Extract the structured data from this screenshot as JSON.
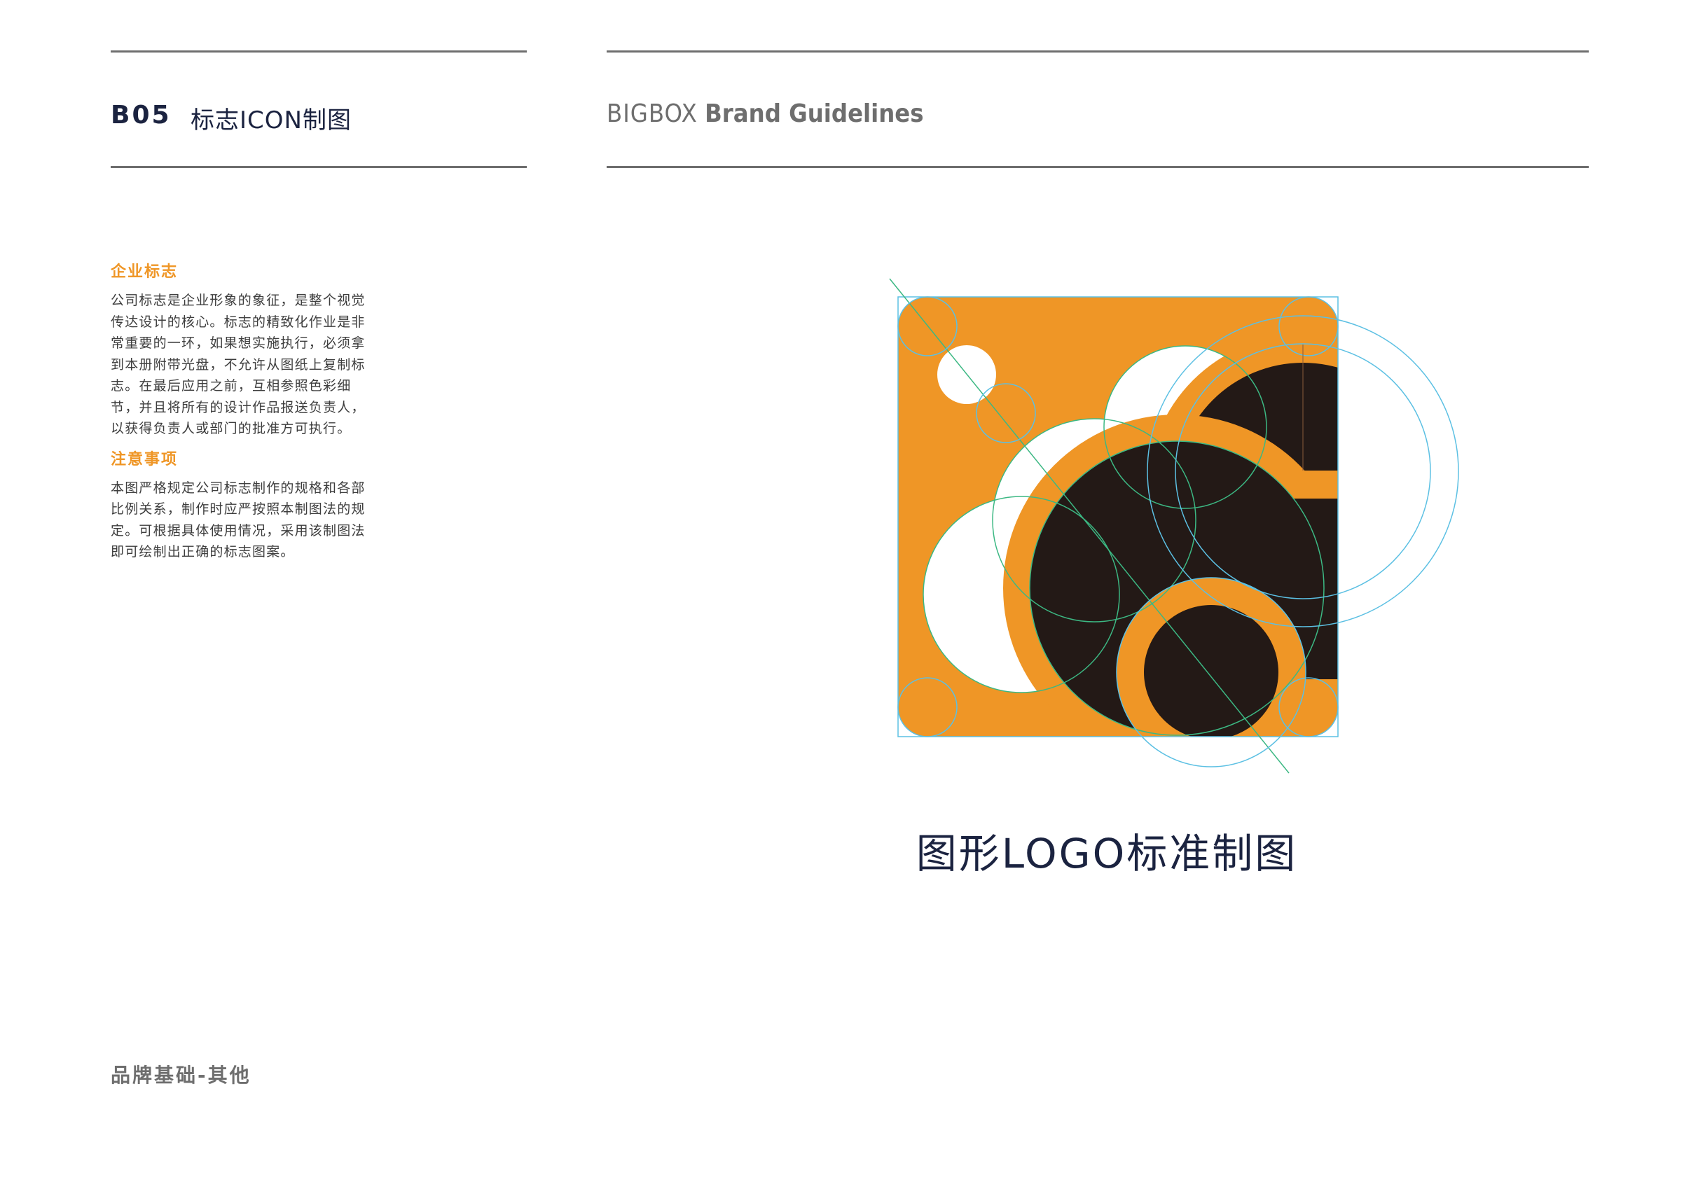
{
  "header": {
    "section_code": "B05",
    "section_title": "标志ICON制图",
    "brand_name": "BIGBOX",
    "brand_subtitle": "Brand Guidelines"
  },
  "sidebar": {
    "block1": {
      "heading": "企业标志",
      "text": "公司标志是企业形象的象征，是整个视觉\n传达设计的核心。标志的精致化作业是非\n常重要的一环，如果想实施执行，必须拿\n到本册附带光盘，不允许从图纸上复制标\n志。在最后应用之前，互相参照色彩细\n节，并且将所有的设计作品报送负责人，\n以获得负责人或部门的批准方可执行。"
    },
    "block2": {
      "heading": "注意事项",
      "text": "本图严格规定公司标志制作的规格和各部\n比例关系，制作时应严按照本制图法的规\n定。可根据具体使用情况，采用该制图法\n即可绘制出正确的标志图案。"
    }
  },
  "footer": {
    "label": "品牌基础-其他"
  },
  "main": {
    "caption": "图形LOGO标准制图"
  },
  "colors": {
    "brand_orange": "#ef9626",
    "brand_dark": "#231916",
    "guide_blue": "#5cc0e3",
    "guide_green": "#3cb883",
    "text_navy": "#1b2340",
    "rule_gray": "#6e6e6e"
  }
}
